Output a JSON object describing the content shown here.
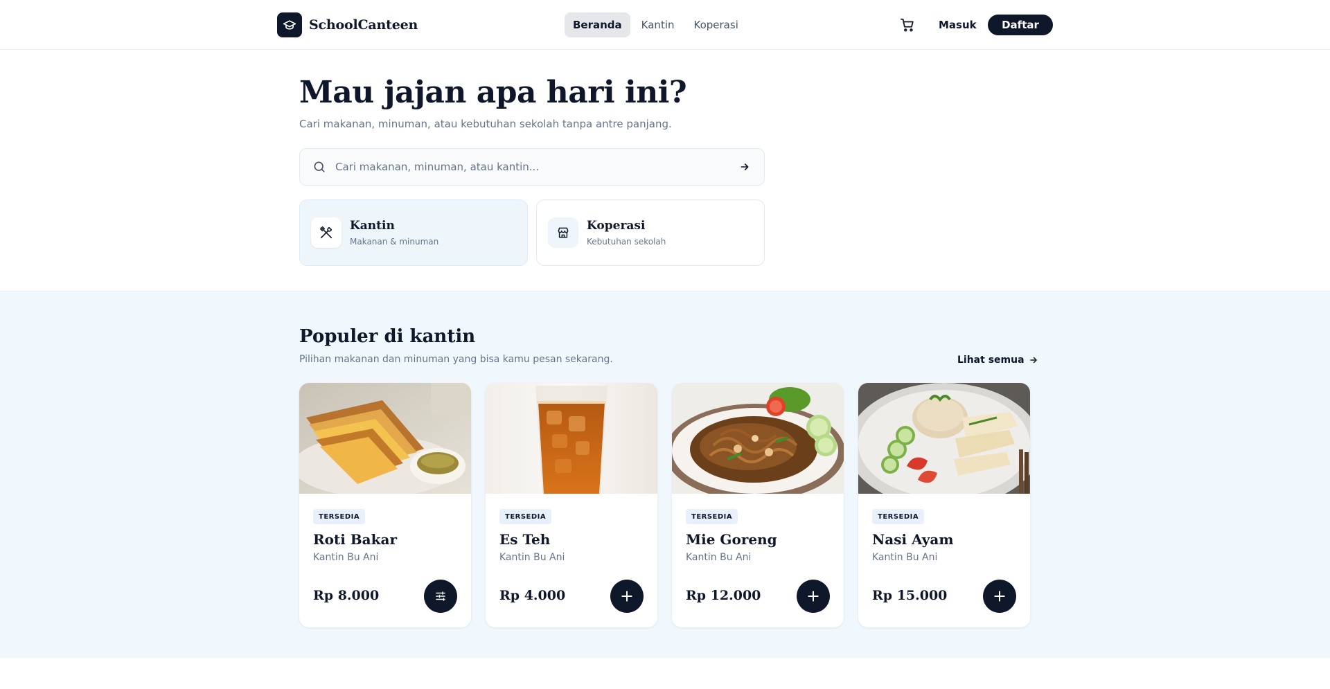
{
  "header": {
    "brand": "SchoolCanteen",
    "nav": [
      {
        "label": "Beranda",
        "active": true
      },
      {
        "label": "Kantin",
        "active": false
      },
      {
        "label": "Koperasi",
        "active": false
      }
    ],
    "cart_icon": "cart-icon",
    "login_label": "Masuk",
    "register_label": "Daftar"
  },
  "hero": {
    "title": "Mau jajan apa hari ini?",
    "subtitle": "Cari makanan, minuman, atau kebutuhan sekolah tanpa antre panjang.",
    "search": {
      "placeholder": "Cari makanan, minuman, atau kantin...",
      "value": ""
    },
    "categories": [
      {
        "title": "Kantin",
        "desc": "Makanan & minuman",
        "icon": "utensils-icon",
        "active": true
      },
      {
        "title": "Koperasi",
        "desc": "Kebutuhan sekolah",
        "icon": "store-icon",
        "active": false
      }
    ]
  },
  "popular": {
    "title": "Populer di kantin",
    "subtitle": "Pilihan makanan dan minuman yang bisa kamu pesan sekarang.",
    "see_all": "Lihat semua",
    "items": [
      {
        "status": "TERSEDIA",
        "name": "Roti Bakar",
        "shop": "Kantin Bu Ani",
        "price": "Rp 8.000",
        "action_icon": "sliders-icon"
      },
      {
        "status": "TERSEDIA",
        "name": "Es Teh",
        "shop": "Kantin Bu Ani",
        "price": "Rp 4.000",
        "action_icon": "plus-icon"
      },
      {
        "status": "TERSEDIA",
        "name": "Mie Goreng",
        "shop": "Kantin Bu Ani",
        "price": "Rp 12.000",
        "action_icon": "plus-icon"
      },
      {
        "status": "TERSEDIA",
        "name": "Nasi Ayam",
        "shop": "Kantin Bu Ani",
        "price": "Rp 15.000",
        "action_icon": "plus-icon"
      }
    ]
  },
  "colors": {
    "primary": "#0f172a",
    "section_bg": "#f0f7fd",
    "badge_bg": "#e8f1fb",
    "muted_text": "#64748b"
  }
}
